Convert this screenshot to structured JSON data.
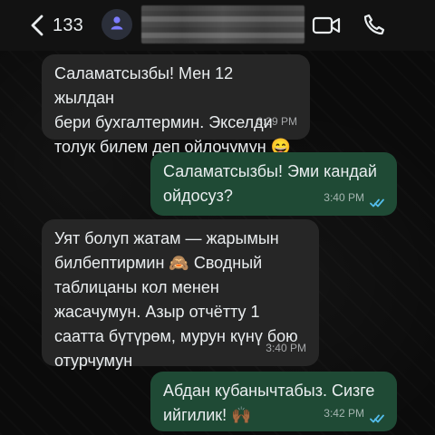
{
  "header": {
    "unread_count": "133",
    "contact_name_blurred": true
  },
  "colors": {
    "incoming_bubble": "#262626",
    "outgoing_bubble": "#1f4a35",
    "read_ticks": "#53bdeb",
    "text": "#e9edef"
  },
  "icons": {
    "back": "chevron-left-icon",
    "avatar": "person-icon",
    "video": "video-call-icon",
    "phone": "phone-icon",
    "read": "double-check-icon"
  },
  "messages": [
    {
      "direction": "incoming",
      "text": "Саламатсызбы! Мен 12 жылдан\nбери бухгалтермин. Экселди\nтолук билем деп ойлочумун 😄",
      "time": "3:39 PM",
      "read": false
    },
    {
      "direction": "outgoing",
      "text": "Саламатсызбы! Эми кандай\nойдосуз?",
      "time": "3:40 PM",
      "read": true
    },
    {
      "direction": "incoming",
      "text": "Уят болуп жатам — жарымын\nбилбептирмин 🙈 Сводный\nтаблицаны кол менен\nжасачумун. Азыр отчётту 1\nсаатта бүтүрөм, мурун күнү бою\nотурчумун",
      "time": "3:40 PM",
      "read": false
    },
    {
      "direction": "outgoing",
      "text": "Абдан кубанычтабыз. Сизге\nийгилик! 🙌🏾",
      "time": "3:42 PM",
      "read": true
    }
  ]
}
